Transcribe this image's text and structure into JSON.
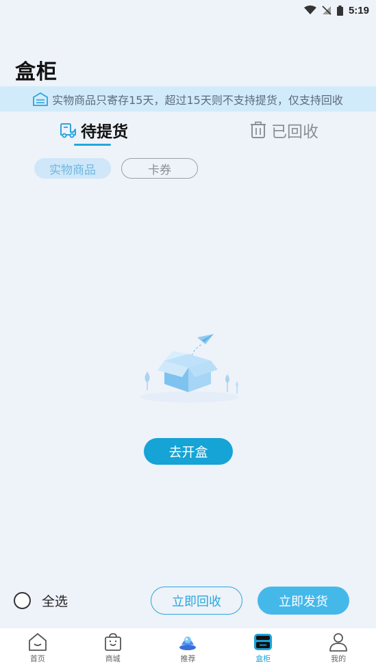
{
  "status_bar": {
    "time": "5:19"
  },
  "header": {
    "title": "盒柜"
  },
  "notice": {
    "text": "实物商品只寄存15天，超过15天则不支持提货，仅支持回收"
  },
  "tabs": [
    {
      "label": "待提货",
      "active": true,
      "icon": "truck-icon"
    },
    {
      "label": "已回收",
      "active": false,
      "icon": "trash-icon"
    }
  ],
  "filters": [
    {
      "label": "实物商品",
      "active": true
    },
    {
      "label": "卡券",
      "active": false
    }
  ],
  "empty_state": {
    "button_label": "去开盒"
  },
  "actions": {
    "select_all_label": "全选",
    "recycle_label": "立即回收",
    "ship_label": "立即发货"
  },
  "bottom_nav": [
    {
      "label": "首页",
      "icon": "home-icon"
    },
    {
      "label": "商城",
      "icon": "shopping-bag-icon"
    },
    {
      "label": "推荐",
      "icon": "recommend-icon"
    },
    {
      "label": "盒柜",
      "icon": "box-cabinet-icon",
      "active": true
    },
    {
      "label": "我的",
      "icon": "profile-icon"
    }
  ],
  "colors": {
    "accent": "#16a3d6",
    "banner": "#d2ebfb",
    "background": "#eef2f9"
  }
}
